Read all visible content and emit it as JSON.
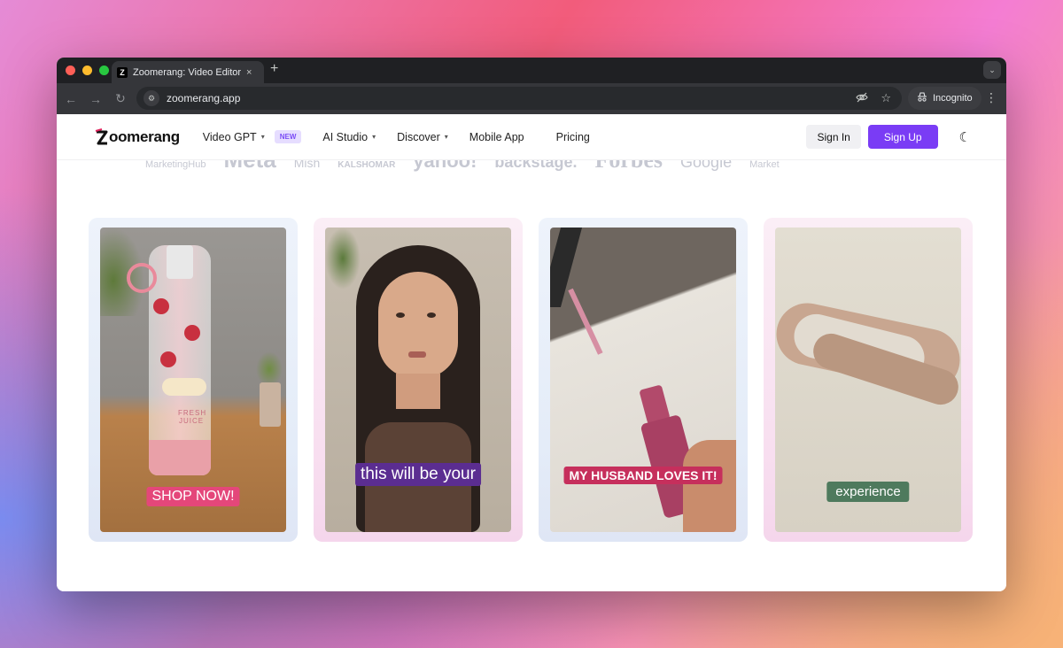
{
  "browser": {
    "tab_title": "Zoomerang: Video Editor & Vi",
    "tab_close": "×",
    "new_tab": "+",
    "url": "zoomerang.app",
    "incognito_label": "Incognito",
    "icons": [
      "back-arrow-icon",
      "forward-arrow-icon",
      "reload-icon",
      "site-info-icon",
      "eye-off-icon",
      "star-icon",
      "incognito-icon",
      "kebab-menu-icon",
      "tab-search-icon"
    ]
  },
  "nav": {
    "logo": "oomerang",
    "items": [
      {
        "label": "Video GPT",
        "dropdown": true,
        "badge": "NEW"
      },
      {
        "label": "AI Studio",
        "dropdown": true
      },
      {
        "label": "Discover",
        "dropdown": true
      },
      {
        "label": "Mobile App",
        "dropdown": false
      },
      {
        "label": "Pricing",
        "dropdown": false
      }
    ],
    "sign_in": "Sign In",
    "sign_up": "Sign Up"
  },
  "partner_logos": [
    "MarketingHub",
    "Meta",
    "Mish",
    "KALSHOMAR",
    "yahoo!",
    "backstage.",
    "Forbes",
    "Google",
    "Market"
  ],
  "cards": [
    {
      "caption": "SHOP NOW!",
      "product_text": "FRESH JUICE"
    },
    {
      "caption": "this will be your"
    },
    {
      "caption": "MY HUSBAND LOVES IT!"
    },
    {
      "caption": "experience"
    }
  ],
  "colors": {
    "accent": "#7a3cf5",
    "badge_bg": "#e6ddff",
    "caption1": "#e4477a",
    "caption2": "#5b2d91",
    "caption3": "#c62f5c",
    "caption4": "#4e7a5d"
  }
}
